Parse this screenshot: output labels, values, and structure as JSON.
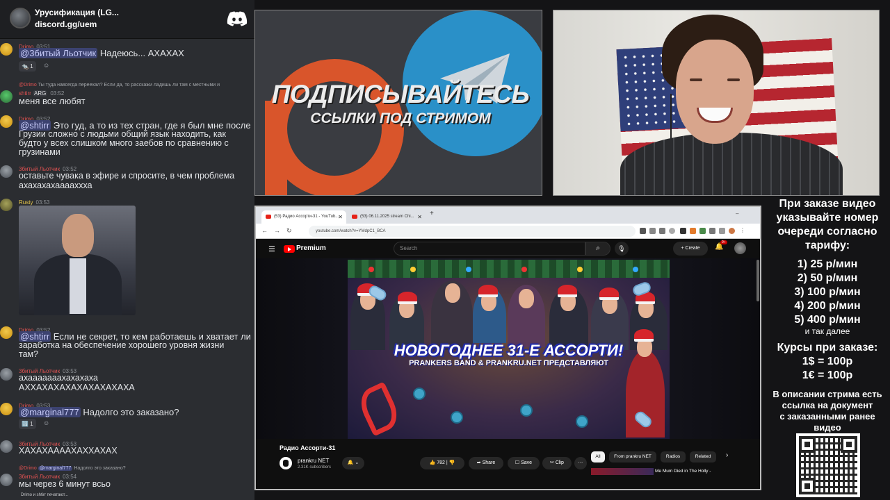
{
  "discord": {
    "server_name": "Урусификация (LG...",
    "server_link": "discord.gg/uem",
    "messages": [
      {
        "user": "Drimo",
        "time": "03:51",
        "mention": "@3битый Льотчик",
        "text": "Надеюсь... АХАХАХ",
        "reaction_count": "1"
      },
      {
        "reply_user": "@Drimo",
        "reply_text": "Ты туда навсегда переехал? Если да, то расскажи ладишь ли там с местными и",
        "user": "shtirr",
        "tag": "ARG",
        "time": "03:52",
        "text": "меня все любят"
      },
      {
        "user": "Drimo",
        "time": "03:52",
        "mention": "@shtirr",
        "text_lines": [
          "Это гуд, а то из тех стран, где я был мне после",
          "Грузии сложно с людьми общий язык находить, как",
          "будто у всех слишком много заебов по сравнению с",
          "грузинами"
        ]
      },
      {
        "user": "3битый Льотчик",
        "time": "03:52",
        "text_lines": [
          "оставьте чувака в эфире и спросите, в  чем проблема",
          "ахахахахааааххха"
        ]
      },
      {
        "user": "Rusty",
        "time": "03:53"
      },
      {
        "user": "Drimo",
        "time": "03:52",
        "mention": "@shtirr",
        "text_lines": [
          "Если не секрет, то кем работаешь и хватает ли",
          "заработка на обеспечение хорошего уровня жизни",
          "там?"
        ]
      },
      {
        "user": "3битый Льотчик",
        "time": "03:53",
        "text_lines": [
          "ахааааааахахахаха",
          "АХХАХАХАХАХАХАХАХАХА"
        ]
      },
      {
        "user": "Drimo",
        "time": "03:53",
        "mention": "@marginal777",
        "text": "Надолго это заказано?",
        "reaction_count": "1"
      },
      {
        "user": "3битый Льотчик",
        "time": "03:53",
        "text": "ХАХАХААААХАХХАХАХ"
      },
      {
        "reply_user": "@Drimo",
        "reply_mention": "@marginal777",
        "reply_text": "Надолго это заказано?",
        "user": "3битый Льотчик",
        "time": "03:54",
        "text": "мы через 6 минут всьо"
      }
    ],
    "typing": "Drimo и shtirr печатают..."
  },
  "promo": {
    "title": "ПОДПИСЫВАЙТЕСЬ",
    "subtitle": "ССЫЛКИ ПОД СТРИМОМ"
  },
  "browser": {
    "tabs": [
      "(53) Радио Ассорти-31 - YouTub...",
      "(53) 06.11.2025 stream Chi..."
    ],
    "url": "youtube.com/watch?v=YMdpC1_BCA",
    "yt": {
      "brand": "Premium",
      "search_placeholder": "Search",
      "create_label": "Create",
      "notif_badge": "9+",
      "thumb_title": "НОВОГОДНЕЕ 31-Е АССОРТИ!",
      "thumb_subtitle": "PRANKERS BAND & PRANKRU.NET ПРЕДСТАВЛЯЮТ",
      "video_title": "Радио Ассорти-31",
      "channel_name": "prankru NET",
      "subscribers": "2.31K subscribers",
      "likes": "782",
      "share": "Share",
      "save": "Save",
      "clip": "Clip",
      "chips": [
        "All",
        "From prankru NET",
        "Radios",
        "Related"
      ],
      "rec_title": "Me Mum Died in The Holly -"
    }
  },
  "info": {
    "lines": [
      "При заказе видео",
      "указывайте номер",
      "очереди согласно",
      "тарифу:"
    ],
    "tariffs": [
      "1) 25 р/мин",
      "2) 50 р/мин",
      "3) 100 р/мин",
      "4) 200 р/мин",
      "5) 400 р/мин"
    ],
    "etc": "и так далее",
    "rates_title": "Курсы при заказе:",
    "rates": [
      "1$ = 100р",
      "1€ = 100р"
    ],
    "desc_lines": [
      "В описании стрима есть",
      "ссылка на документ",
      "с заказанными ранее",
      "видео"
    ]
  }
}
